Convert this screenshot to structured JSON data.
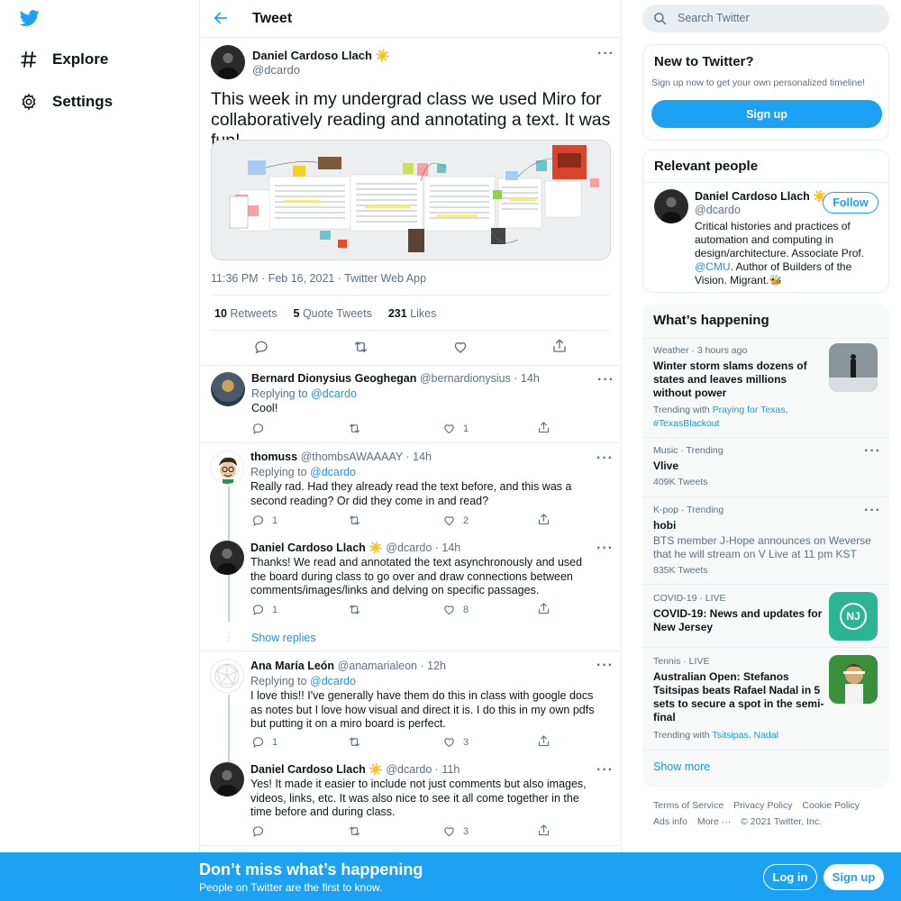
{
  "nav": {
    "explore_label": "Explore",
    "settings_label": "Settings"
  },
  "header": {
    "title": "Tweet"
  },
  "tweet": {
    "author_name": "Daniel Cardoso Llach",
    "author_emoji": "☀️",
    "author_handle": "@dcardo",
    "text": "This week in my undergrad class we used Miro for collaboratively reading and annotating a text. It was fun!",
    "timestamp": "11:36 PM · Feb 16, 2021 · Twitter Web App",
    "stats": {
      "retweets_count": "10",
      "retweets_label": "Retweets",
      "quotes_count": "5",
      "quotes_label": "Quote Tweets",
      "likes_count": "231",
      "likes_label": "Likes"
    }
  },
  "replies": [
    {
      "name": "Bernard Dionysius Geoghegan",
      "handle": "@bernardionysius",
      "time": "· 14h",
      "replying_label": "Replying to",
      "replying_to": "@dcardo",
      "text": "Cool!",
      "reply_count": "",
      "like_count": "1"
    },
    {
      "name": "thomuss",
      "handle": "@thombsAWAAAAY",
      "time": "· 14h",
      "replying_label": "Replying to",
      "replying_to": "@dcardo",
      "text": "Really rad. Had they already read the text before, and this was a second reading? Or did they come in and read?",
      "reply_count": "1",
      "like_count": "2"
    },
    {
      "name": "Daniel Cardoso Llach",
      "emoji": "☀️",
      "handle": "@dcardo",
      "time": "· 14h",
      "text": "Thanks! We read and annotated the text asynchronously and used the board during class to go over and draw connections between comments/images/links and delving on specific passages.",
      "reply_count": "1",
      "like_count": "8"
    },
    {
      "name": "Ana María León",
      "handle": "@anamarialeon",
      "time": "· 12h",
      "replying_label": "Replying to",
      "replying_to": "@dcardo",
      "text": "I love this!! I've generally have them do this in class with google docs as notes but I love how visual and direct it is. I do this in my own pdfs but putting it on a miro board is perfect.",
      "reply_count": "1",
      "like_count": "3"
    },
    {
      "name": "Daniel Cardoso Llach",
      "emoji": "☀️",
      "handle": "@dcardo",
      "time": "· 11h",
      "text": "Yes! It made it easier to include not just comments but also images, videos, links, etc. It was also nice to see it all come together in the time before and during class.",
      "reply_count": "",
      "like_count": "3"
    }
  ],
  "show_replies_label": "Show replies",
  "search": {
    "placeholder": "Search Twitter"
  },
  "new_to_twitter": {
    "title": "New to Twitter?",
    "subtitle": "Sign up now to get your own personalized timeline!",
    "button": "Sign up"
  },
  "relevant_people": {
    "title": "Relevant people",
    "name": "Daniel Cardoso Llach",
    "emoji": "☀️",
    "handle": "@dcardo",
    "follow": "Follow",
    "bio_pre": "Critical histories and practices of automation and computing in design/architecture. Associate Prof.",
    "bio_link": "@CMU",
    "bio_post": ". Author of Builders of the Vision. Migrant.",
    "bio_emoji": "🐝"
  },
  "whats_happening": {
    "title": "What’s happening",
    "trends": [
      {
        "meta": "Weather · 3 hours ago",
        "title": "Winter storm slams dozens of states and leaves millions without power",
        "trending_label": "Trending with",
        "trending_links": [
          "Praying for Texas,",
          "#TexasBlackout"
        ]
      },
      {
        "meta": "Music · Trending",
        "title": "Vlive",
        "count": "409K Tweets"
      },
      {
        "meta": "K-pop · Trending",
        "title": "hobi",
        "desc": "BTS member J-Hope announces on Weverse that he will stream on V Live at 11 pm KST",
        "count": "835K Tweets"
      },
      {
        "meta": "COVID-19 · LIVE",
        "title": "COVID-19: News and updates for New Jersey",
        "badge": "NJ"
      },
      {
        "meta": "Tennis · LIVE",
        "title": "Australian Open: Stefanos Tsitsipas beats Rafael Nadal in 5 sets to secure a spot in the semi-final",
        "trending_label": "Trending with",
        "trending_links": [
          "Tsitsipas,",
          "Nadal"
        ]
      }
    ],
    "show_more": "Show more"
  },
  "footer": {
    "links": [
      "Terms of Service",
      "Privacy Policy",
      "Cookie Policy",
      "Ads info",
      "More ···",
      "© 2021 Twitter, Inc."
    ]
  },
  "bottom_bar": {
    "title": "Don’t miss what’s happening",
    "subtitle": "People on Twitter are the first to know.",
    "login": "Log in",
    "signup": "Sign up"
  },
  "colors": {
    "brand_blue": "#1da1f2",
    "link_blue": "#1b95e0",
    "muted_text": "#5b7083",
    "border": "#ebeef0"
  }
}
